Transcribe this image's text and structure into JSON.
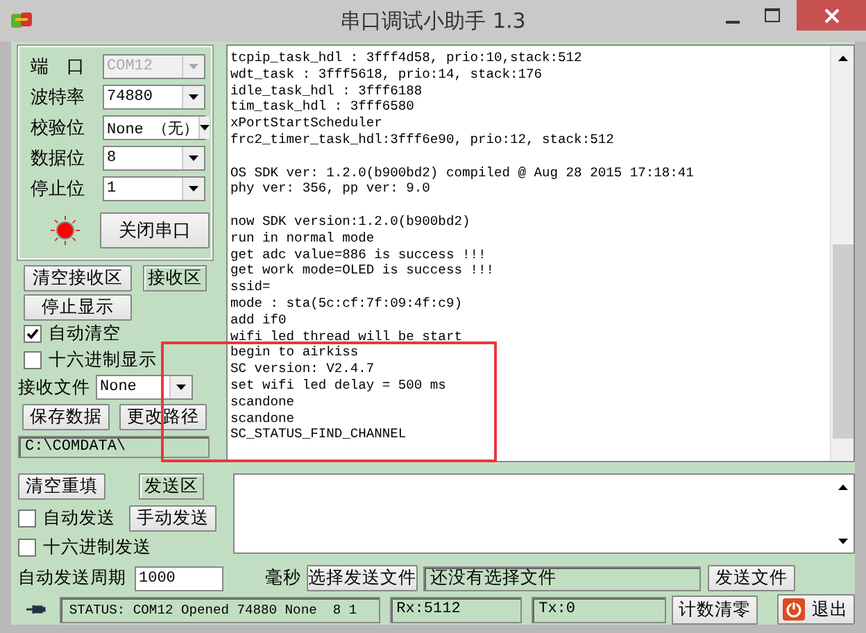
{
  "window": {
    "title": "串口调试小助手 1.3"
  },
  "port_settings": [
    {
      "label": "端　口",
      "value": "COM12",
      "disabled": true
    },
    {
      "label": "波特率",
      "value": "74880",
      "disabled": false
    },
    {
      "label": "校验位",
      "value": "None （无）",
      "disabled": false
    },
    {
      "label": "数据位",
      "value": "8",
      "disabled": false
    },
    {
      "label": "停止位",
      "value": "1",
      "disabled": false
    }
  ],
  "port_lamp": {
    "on": true
  },
  "toggle_port_button": "关闭串口",
  "receive": {
    "clear_button": "清空接收区",
    "area_label": "接收区",
    "stop_button": "停止显示",
    "options": [
      {
        "label": "自动清空",
        "checked": true
      },
      {
        "label": "十六进制显示",
        "checked": false
      }
    ],
    "file_label": "接收文件",
    "file_value": "None",
    "save_button": "保存数据",
    "path_button": "更改路径",
    "path": "C:\\COMDATA\\",
    "log_blocks": [
      [
        "tcpip_task_hdl : 3fff4d58, prio:10,stack:512",
        "wdt_task : 3fff5618, prio:14, stack:176",
        "idle_task_hdl : 3fff6188",
        "tim_task_hdl : 3fff6580",
        "xPortStartScheduler",
        "frc2_timer_task_hdl:3fff6e90, prio:12, stack:512"
      ],
      [
        "OS SDK ver: 1.2.0(b900bd2) compiled @ Aug 28 2015 17:18:41",
        "phy ver: 356, pp ver: 9.0"
      ],
      [
        "now SDK version:1.2.0(b900bd2)",
        "run in normal mode",
        "get adc value=886 is success !!!",
        "get work mode=OLED is success !!!",
        "ssid=",
        "mode : sta(5c:cf:7f:09:4f:c9)",
        "add if0",
        "wifi led thread will be start",
        "begin to airkiss",
        "SC version: V2.4.7",
        "set wifi led delay = 500 ms",
        "scandone",
        "scandone",
        "SC_STATUS_FIND_CHANNEL"
      ]
    ]
  },
  "highlight_box": true,
  "send": {
    "clear_button": "清空重填",
    "area_label": "发送区",
    "manual_button": "手动发送",
    "options": [
      {
        "label": "自动发送",
        "checked": false
      },
      {
        "label": "十六进制发送",
        "checked": false
      }
    ],
    "period_label": "自动发送周期",
    "period_value": "1000",
    "period_unit": "毫秒",
    "choose_file_button": "选择发送文件",
    "file_status": "还没有选择文件",
    "send_file_button": "发送文件"
  },
  "status_bar": {
    "status": "STATUS: COM12 Opened 74880 None  8 1",
    "rx": "Rx:5112",
    "tx": "Tx:0",
    "reset_button": "计数清零",
    "exit_button": "退出"
  }
}
